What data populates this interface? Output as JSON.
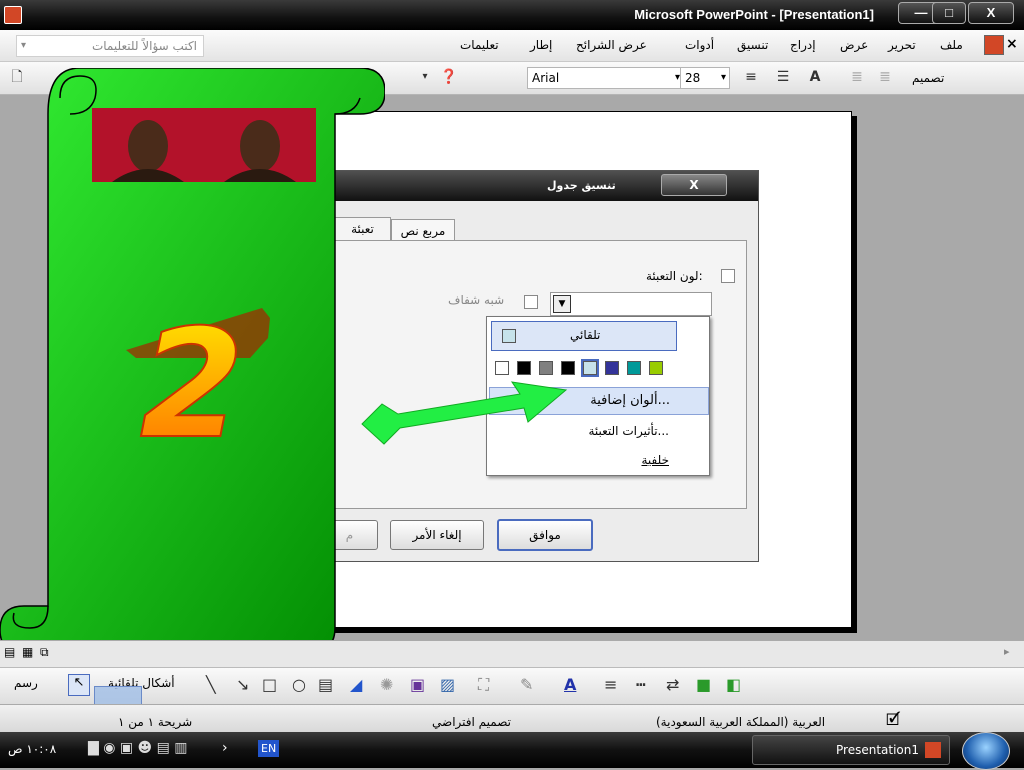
{
  "window": {
    "title": "Microsoft PowerPoint - [Presentation1]",
    "controls": {
      "minimize": "—",
      "maximize": "□",
      "close": "X"
    }
  },
  "menubar": {
    "close_glyph": "×",
    "items": [
      "ملف",
      "تحرير",
      "عرض",
      "إدراج",
      "تنسيق",
      "أدوات",
      "عرض الشرائح",
      "إطار",
      "تعليمات"
    ],
    "ask_placeholder": "اكتب سؤالاً للتعليمات"
  },
  "toolbar": {
    "font_name": "Arial",
    "font_size": "28",
    "design_label": "تصميم"
  },
  "dialog": {
    "title": "تنسيق جدول",
    "close_glyph": "X",
    "tabs": [
      "تعبئة",
      "مربع نص"
    ],
    "fill_color_label": "لون التعبئة:",
    "semi_transparent_label": "شبه شفاف",
    "ok_label": "موافق",
    "cancel_label": "إلغاء الأمر",
    "preview_label": "م"
  },
  "color_popup": {
    "automatic_label": "تلقائي",
    "more_colors_label": "ألوان إضافية...",
    "fill_effects_label": "تأثيرات التعبئة...",
    "background_label": "خلفية",
    "swatches": [
      "#ffffff",
      "#000000",
      "#808080",
      "#000000",
      "#c6e2ea",
      "#333399",
      "#009999",
      "#99cc00"
    ]
  },
  "banner": {
    "number": "2"
  },
  "drawbar": {
    "draw_label": "رسم",
    "autoshapes_label": "أشكال تلقائية"
  },
  "statusbar": {
    "slide_info": "شريحة ١ من ١",
    "design": "تصميم افتراضي",
    "language": "العربية (المملكة العربية السعودية)"
  },
  "taskbar": {
    "clock": "١٠:٠٨ ص",
    "lang": "EN",
    "task_label": "Presentation1"
  },
  "colors": {
    "banner_green": "#22cc22",
    "arrow_green": "#22ee44",
    "accent_blue": "#4a6bbf"
  }
}
